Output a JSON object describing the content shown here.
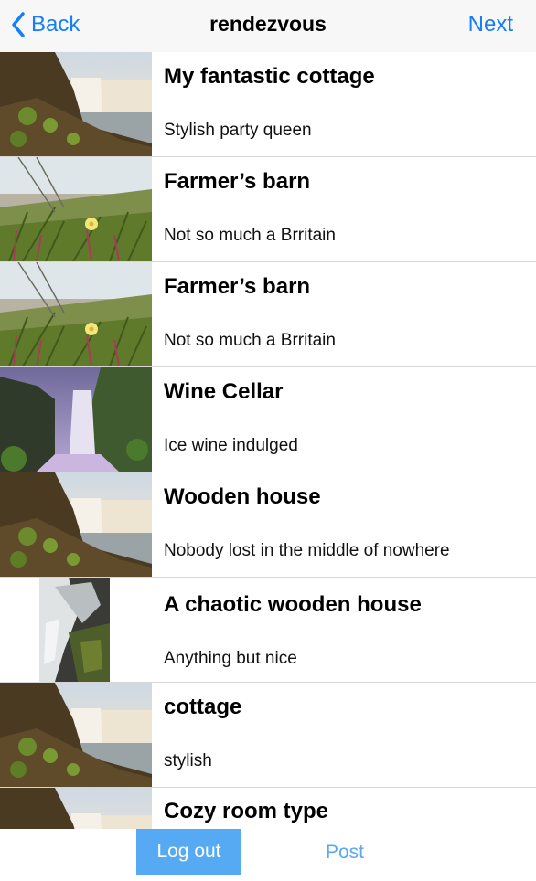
{
  "navbar": {
    "back_label": "Back",
    "title": "rendezvous",
    "next_label": "Next"
  },
  "rows": [
    {
      "title": "My fantastic cottage",
      "subtitle": "Stylish party queen",
      "thumbnail": "waterfall-cliff"
    },
    {
      "title": "Farmer’s barn",
      "subtitle": "Not so much a Brritain",
      "thumbnail": "grass-flower"
    },
    {
      "title": "Farmer’s barn",
      "subtitle": "Not so much a Brritain",
      "thumbnail": "grass-flower"
    },
    {
      "title": "Wine Cellar",
      "subtitle": "Ice wine indulged",
      "thumbnail": "waterfall-purple"
    },
    {
      "title": "Wooden house",
      "subtitle": "Nobody lost in the middle of nowhere",
      "thumbnail": "waterfall-cliff"
    },
    {
      "title": "A chaotic wooden house",
      "subtitle": "Anything but nice",
      "thumbnail": "stream-rocks"
    },
    {
      "title": "cottage",
      "subtitle": "stylish",
      "thumbnail": "waterfall-cliff"
    },
    {
      "title": "Cozy room type",
      "subtitle": "",
      "thumbnail": "waterfall-cliff"
    }
  ],
  "toolbar": {
    "logout_label": "Log out",
    "post_label": "Post"
  },
  "colors": {
    "accent": "#147efb",
    "logout_bg": "#55aaf3"
  }
}
